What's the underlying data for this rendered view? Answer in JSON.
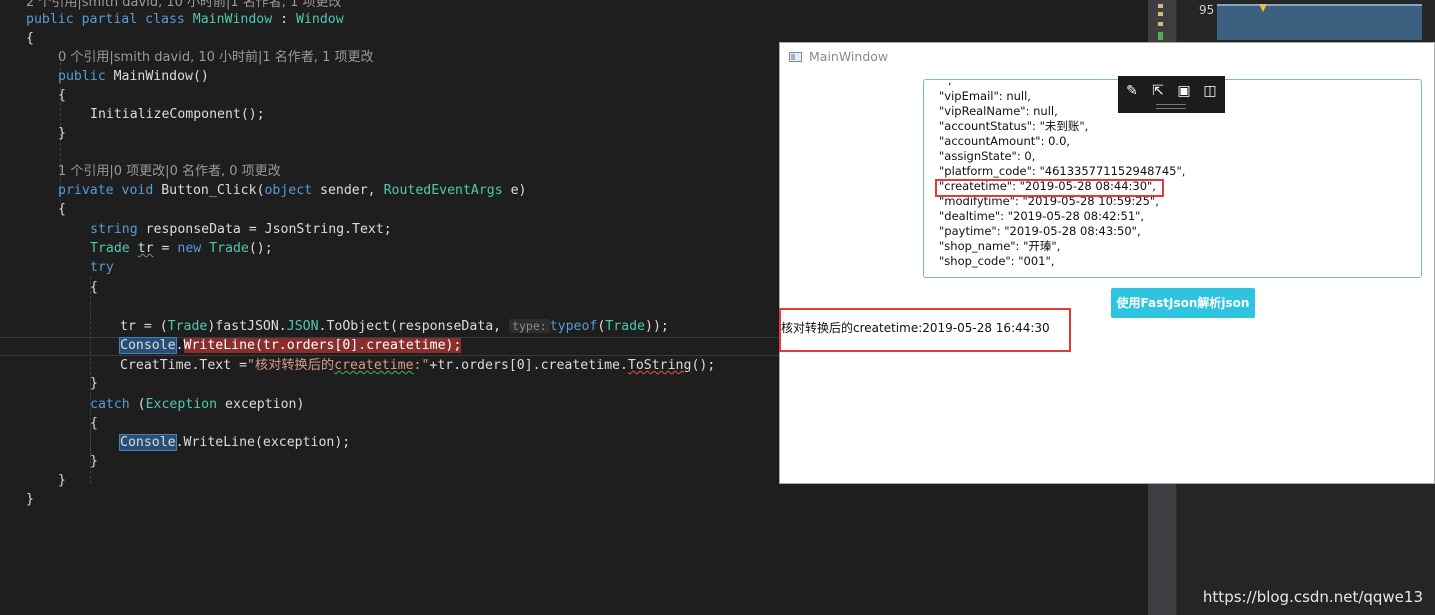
{
  "editor": {
    "lines": [
      {
        "kind": "lens",
        "text": "2 个引用|smith david, 10 小时前|1 名作者, 1 项更改"
      },
      {
        "kind": "code",
        "parts": [
          [
            "kw",
            "public"
          ],
          [
            "p",
            " "
          ],
          [
            "kw",
            "partial"
          ],
          [
            "p",
            " "
          ],
          [
            "kw",
            "class"
          ],
          [
            "p",
            " "
          ],
          [
            "ty",
            "MainWindow"
          ],
          [
            "p",
            " : "
          ],
          [
            "ty",
            "Window"
          ]
        ]
      },
      {
        "kind": "code",
        "parts": [
          [
            "p",
            "{"
          ]
        ]
      },
      {
        "kind": "lens",
        "text": "0 个引用|smith david, 10 小时前|1 名作者, 1 项更改"
      },
      {
        "kind": "code",
        "parts": [
          [
            "kw",
            "public"
          ],
          [
            "p",
            " MainWindow()"
          ]
        ]
      },
      {
        "kind": "code",
        "parts": [
          [
            "p",
            "{"
          ]
        ]
      },
      {
        "kind": "code",
        "parts": [
          [
            "p",
            "InitializeComponent();"
          ]
        ]
      },
      {
        "kind": "code",
        "parts": [
          [
            "p",
            "}"
          ]
        ]
      },
      {
        "kind": "blank"
      },
      {
        "kind": "lens",
        "text": "1 个引用|0 项更改|0 名作者, 0 项更改"
      },
      {
        "kind": "code",
        "parts": [
          [
            "kw",
            "private"
          ],
          [
            "p",
            " "
          ],
          [
            "kw",
            "void"
          ],
          [
            "p",
            " Button_Click("
          ],
          [
            "kw",
            "object"
          ],
          [
            "p",
            " sender, "
          ],
          [
            "ty",
            "RoutedEventArgs"
          ],
          [
            "p",
            " e)"
          ]
        ]
      },
      {
        "kind": "code",
        "parts": [
          [
            "p",
            "{"
          ]
        ]
      },
      {
        "kind": "code",
        "parts": [
          [
            "kw",
            "string"
          ],
          [
            "p",
            " responseData = JsonString.Text;"
          ]
        ]
      },
      {
        "kind": "code",
        "parts": [
          [
            "ty",
            "Trade"
          ],
          [
            "p",
            " "
          ],
          [
            "squig",
            "tr"
          ],
          [
            "p",
            " = "
          ],
          [
            "kw",
            "new"
          ],
          [
            "p",
            " "
          ],
          [
            "ty",
            "Trade"
          ],
          [
            "p",
            "();"
          ]
        ]
      },
      {
        "kind": "code",
        "parts": [
          [
            "kw",
            "try"
          ]
        ]
      },
      {
        "kind": "code",
        "parts": [
          [
            "p",
            "{"
          ]
        ]
      },
      {
        "kind": "blank"
      },
      {
        "kind": "code",
        "parts": [
          [
            "p",
            "tr = ("
          ],
          [
            "ty",
            "Trade"
          ],
          [
            "p",
            ")fastJSON."
          ],
          [
            "ty",
            "JSON"
          ],
          [
            "p",
            ".ToObject(responseData, "
          ],
          [
            "hint",
            "type:"
          ],
          [
            "kw",
            "typeof"
          ],
          [
            "p",
            "("
          ],
          [
            "ty",
            "Trade"
          ],
          [
            "p",
            "));"
          ]
        ]
      },
      {
        "kind": "code",
        "parts": [
          [
            "sel",
            "Console"
          ],
          [
            "p",
            "."
          ],
          [
            "bp",
            "WriteLine(tr.orders[0].createtime);"
          ]
        ]
      },
      {
        "kind": "code",
        "parts": [
          [
            "p",
            "CreatTime.Text ="
          ],
          [
            "str",
            "\"核对转换后的"
          ],
          [
            "squigstr",
            "createtime"
          ],
          [
            "str",
            ":\""
          ],
          [
            "p",
            "+tr.orders[0].createtime."
          ],
          [
            "squigr",
            "ToString"
          ],
          [
            "p",
            "();"
          ]
        ]
      },
      {
        "kind": "code",
        "parts": [
          [
            "p",
            "}"
          ]
        ]
      },
      {
        "kind": "code",
        "parts": [
          [
            "kw",
            "catch"
          ],
          [
            "p",
            " ("
          ],
          [
            "ty",
            "Exception"
          ],
          [
            "p",
            " exception)"
          ]
        ]
      },
      {
        "kind": "code",
        "parts": [
          [
            "p",
            "{"
          ]
        ]
      },
      {
        "kind": "code",
        "parts": [
          [
            "sel",
            "Console"
          ],
          [
            "p",
            ".WriteLine(exception);"
          ]
        ]
      },
      {
        "kind": "code",
        "parts": [
          [
            "p",
            "}"
          ]
        ]
      },
      {
        "kind": "code",
        "parts": [
          [
            "p",
            "}"
          ]
        ]
      },
      {
        "kind": "code",
        "parts": [
          [
            "p",
            "}"
          ]
        ]
      }
    ]
  },
  "perf": {
    "value": "95"
  },
  "watermark": "https://blog.csdn.net/qqwe13",
  "window": {
    "title": "MainWindow",
    "json_lines": [
      "\"vipEmail\": null,",
      "\"vipRealName\": null,",
      "\"accountStatus\": \"未到账\",",
      "\"accountAmount\": 0.0,",
      "\"assignState\": 0,",
      "\"platform_code\": \"461335771152948745\",",
      "\"createtime\": \"2019-05-28 08:44:30\",",
      "\"modifytime\": \"2019-05-28 10:59:25\",",
      "\"dealtime\": \"2019-05-28 08:42:51\",",
      "\"paytime\": \"2019-05-28 08:43:50\",",
      "\"shop_name\": \"开瑧\",",
      "\"shop_code\": \"001\","
    ],
    "parse_button": "使用FastJson解析json",
    "result_label": "核对转换后的createtime:2019-05-28 16:44:30"
  }
}
